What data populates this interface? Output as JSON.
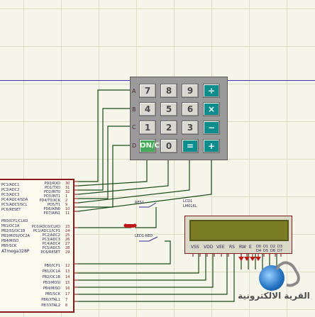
{
  "keypad": {
    "rows": [
      {
        "label": "A",
        "keys": [
          "7",
          "8",
          "9",
          "÷"
        ]
      },
      {
        "label": "B",
        "keys": [
          "4",
          "5",
          "6",
          "×"
        ]
      },
      {
        "label": "C",
        "keys": [
          "1",
          "2",
          "3",
          "−"
        ]
      },
      {
        "label": "D",
        "keys": [
          "ON/C",
          "0",
          "=",
          "+"
        ]
      }
    ]
  },
  "mcu": {
    "left_labels": [
      "PC1/ADC1",
      "PC2/ADC2",
      "PC3/ADC3",
      "PC4/ADC4/SDA",
      "PC5/ADC5/SCL",
      "PC6/RESET",
      "",
      "PB0/ICP1/CLKO",
      "PB1/OC1A",
      "PB2/SS/OC1B",
      "PB3/MOSI/OC2A",
      "PB4/MISO",
      "PB5/SCK",
      "",
      "ATmega328P"
    ],
    "right_labels": [
      "PD0/RXD",
      "PD1/TXD",
      "PD2/INT0",
      "PD3/INT1",
      "PD4/T0/XCK",
      "PD5/T1",
      "PD6/AIN0",
      "PD7/AIN1",
      "",
      "PC0/ADC0/CLKO",
      "PC1/ADC1/ICP1",
      "PC2/ADC2",
      "PC3/ADC3",
      "PC4/ADC4",
      "PC5/ADC5",
      "PC6/RESET",
      "",
      "PB0/ICP1",
      "PB1/OC1A",
      "PB2/OC1B",
      "PB3/MOSI",
      "PB4/MISO",
      "PB5/SCK",
      "PB6/XTAL1",
      "PB7/XTAL2"
    ],
    "pin_numbers": [
      "30",
      "31",
      "32",
      "1",
      "2",
      "9",
      "10",
      "11",
      "",
      "23",
      "24",
      "25",
      "26",
      "27",
      "28",
      "29",
      "",
      "12",
      "13",
      "14",
      "15",
      "16",
      "17",
      "7",
      "8"
    ]
  },
  "lcd": {
    "title": "LCD1",
    "part": "LM016L",
    "pins": [
      "VSS",
      "VDD",
      "VEE",
      "RS",
      "RW",
      "E",
      "D0",
      "D1",
      "D2",
      "D3",
      "D4",
      "D5",
      "D6",
      "D7"
    ]
  },
  "labels": {
    "res1": "RES1",
    "led1": "LED1-RED",
    "lcd_net": "LCD_RED"
  },
  "watermark": {
    "text": "القرية الالكترونية"
  }
}
